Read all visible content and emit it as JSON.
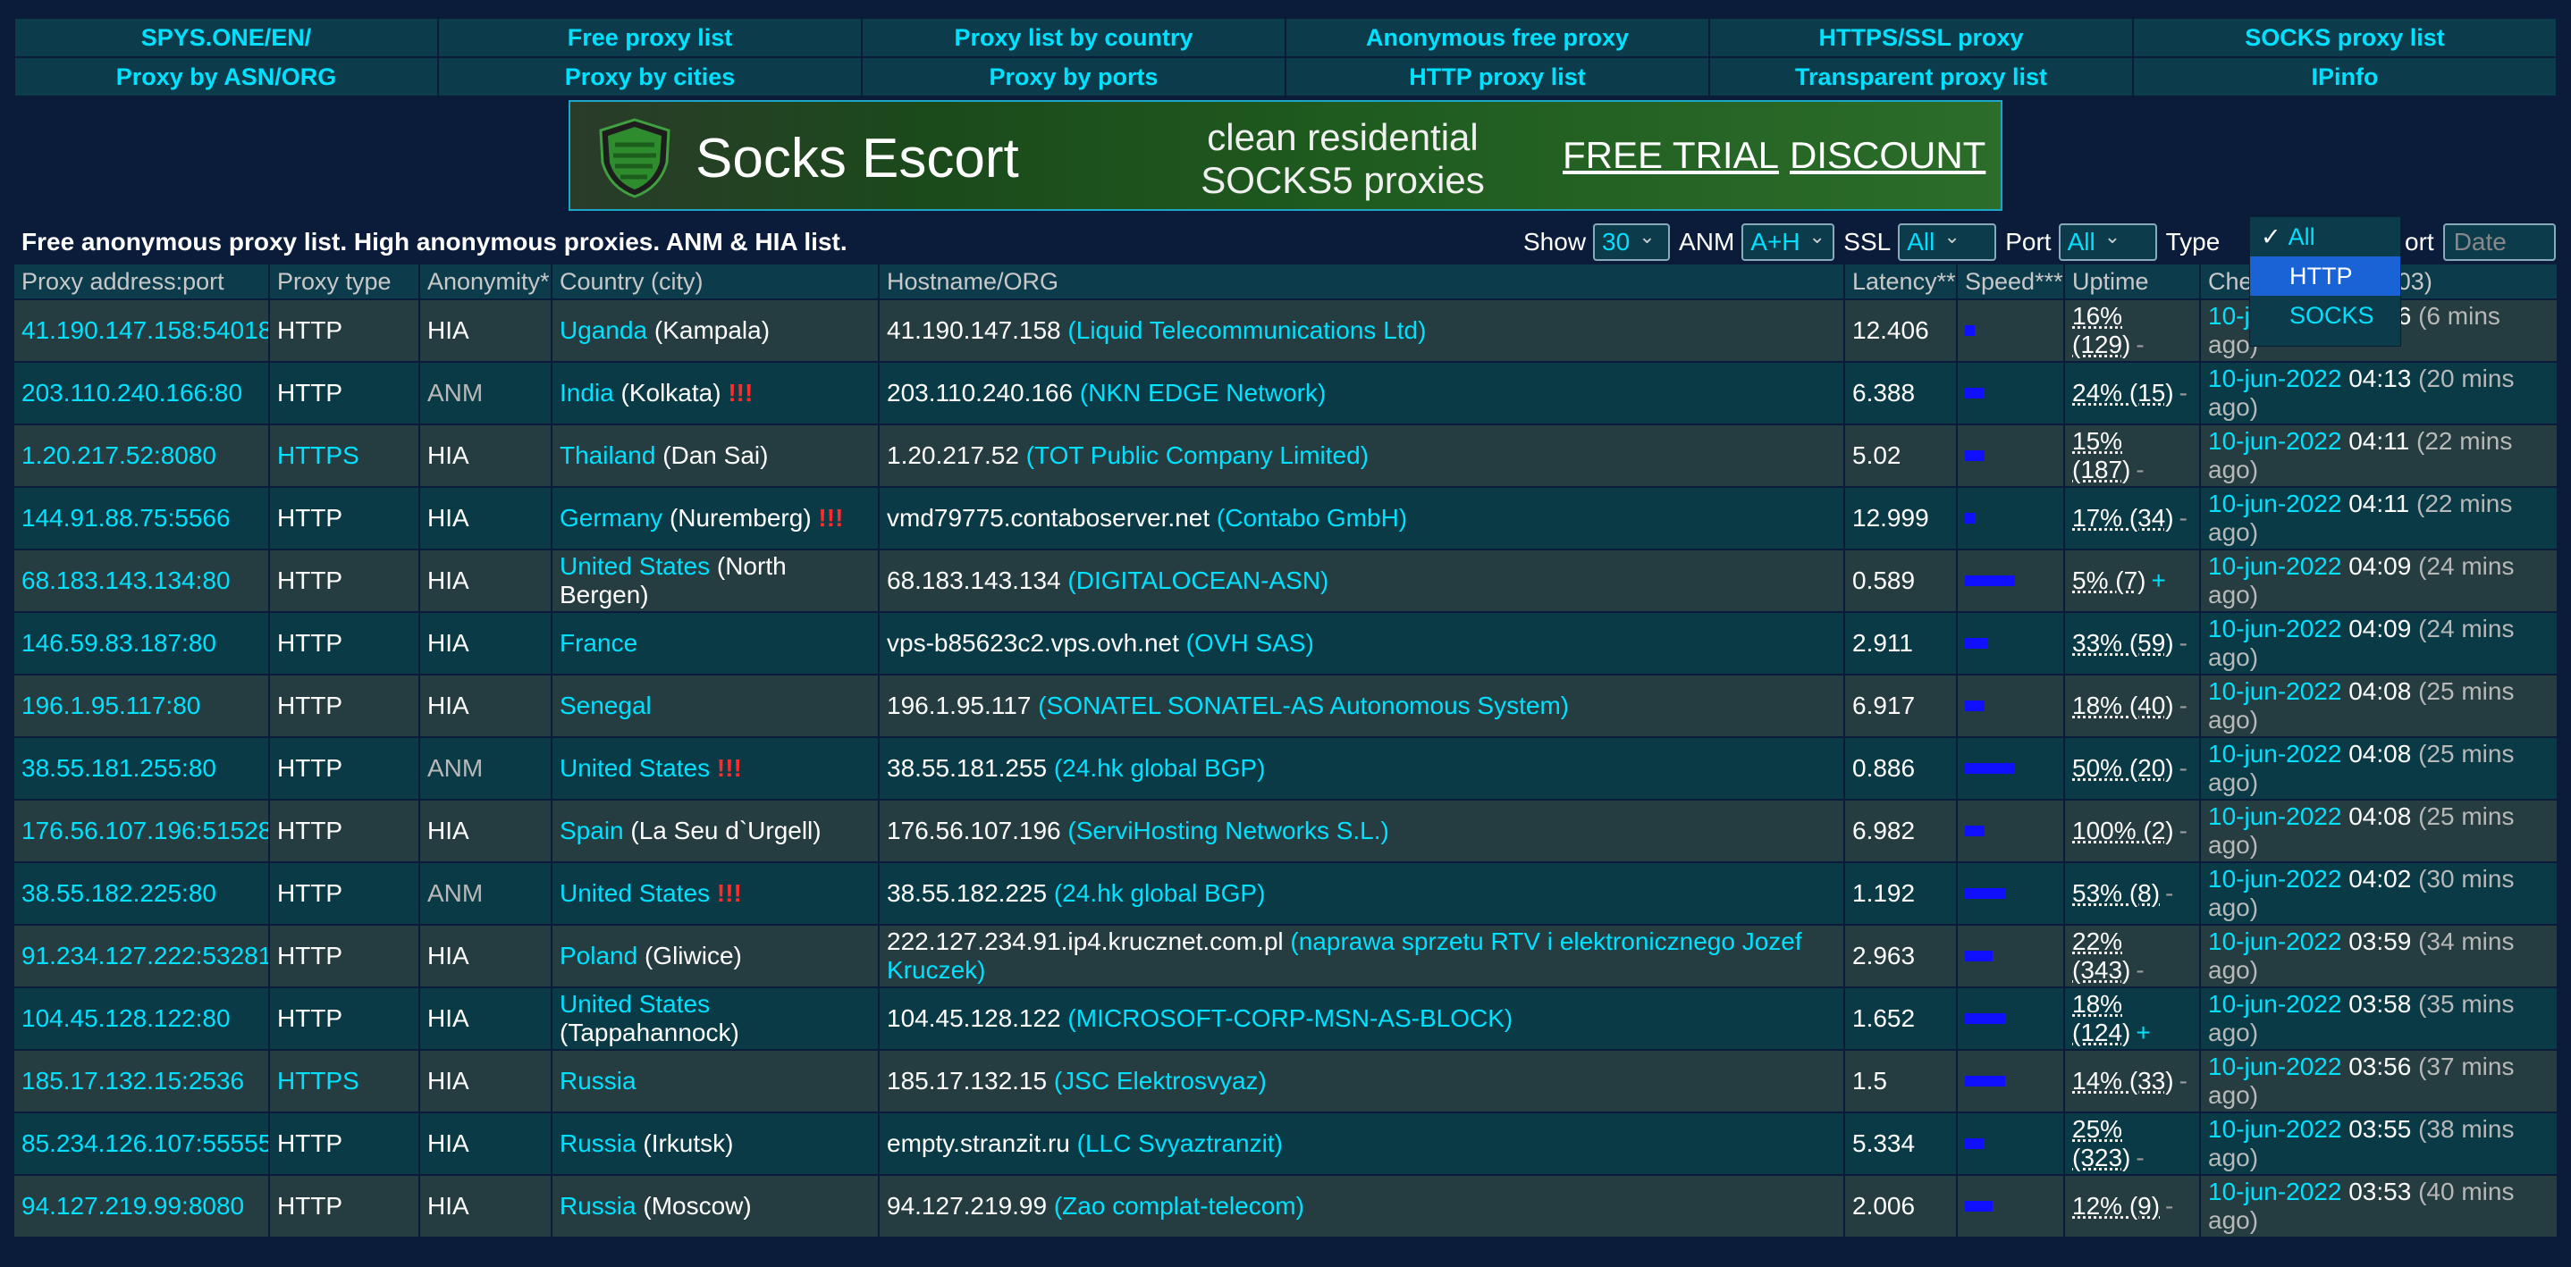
{
  "nav": [
    "SPYS.ONE/EN/",
    "Free proxy list",
    "Proxy list by country",
    "Anonymous free proxy",
    "HTTPS/SSL proxy",
    "SOCKS proxy list",
    "Proxy by ASN/ORG",
    "Proxy by cities",
    "Proxy by ports",
    "HTTP proxy list",
    "Transparent proxy list",
    "IPinfo"
  ],
  "banner": {
    "brand": "Socks Escort",
    "tagline_1": "clean residential",
    "tagline_2": "SOCKS5 proxies",
    "trial": "FREE TRIAL",
    "discount": "DISCOUNT"
  },
  "filter": {
    "title": "Free anonymous proxy list. High anonymous proxies. ANM & HIA list.",
    "show_label": "Show",
    "show_value": "30",
    "anm_label": "ANM",
    "anm_value": "A+H",
    "ssl_label": "SSL",
    "ssl_value": "All",
    "port_label": "Port",
    "port_value": "All",
    "type_label": "Type",
    "sort_label": "ort",
    "sort_value": "Date"
  },
  "type_dropdown": {
    "options": [
      "All",
      "HTTP",
      "SOCKS"
    ],
    "checked": "All",
    "highlighted": "HTTP"
  },
  "headers": [
    "Proxy address:port",
    "Proxy type",
    "Anonymity*",
    "Country (city)",
    "Hostname/ORG",
    "Latency**",
    "Speed***",
    "Uptime",
    "Che",
    "T+03)",
    "6 (6 mins"
  ],
  "rows": [
    {
      "addr": "41.190.147.158:54018",
      "type": "HTTP",
      "anon": "HIA",
      "country": "Uganda",
      "city": "(Kampala)",
      "warn": "",
      "host": "41.190.147.158",
      "org": "(Liquid Telecommunications Ltd)",
      "lat": "12.406",
      "speed": 0.2,
      "up": "16% (129)",
      "mark": "-",
      "date": "10-jun-2022",
      "time": "04:16",
      "ago": "(6 mins",
      "ago2": "ago)"
    },
    {
      "addr": "203.110.240.166:80",
      "type": "HTTP",
      "anon": "ANM",
      "country": "India",
      "city": "(Kolkata)",
      "warn": "!!!",
      "host": "203.110.240.166",
      "org": "(NKN EDGE Network)",
      "lat": "6.388",
      "speed": 0.4,
      "up": "24% (15)",
      "mark": "-",
      "date": "10-jun-2022",
      "time": "04:13",
      "ago": "(20 mins",
      "ago2": "ago)"
    },
    {
      "addr": "1.20.217.52:8080",
      "type": "HTTPS",
      "anon": "HIA",
      "country": "Thailand",
      "city": "(Dan Sai)",
      "warn": "",
      "host": "1.20.217.52",
      "org": "(TOT Public Company Limited)",
      "lat": "5.02",
      "speed": 0.4,
      "up": "15% (187)",
      "mark": "-",
      "date": "10-jun-2022",
      "time": "04:11",
      "ago": "(22 mins",
      "ago2": "ago)"
    },
    {
      "addr": "144.91.88.75:5566",
      "type": "HTTP",
      "anon": "HIA",
      "country": "Germany",
      "city": "(Nuremberg)",
      "warn": "!!!",
      "host": "vmd79775.contaboserver.net",
      "org": "(Contabo GmbH)",
      "lat": "12.999",
      "speed": 0.2,
      "up": "17% (34)",
      "mark": "-",
      "date": "10-jun-2022",
      "time": "04:11",
      "ago": "(22 mins",
      "ago2": "ago)"
    },
    {
      "addr": "68.183.143.134:80",
      "type": "HTTP",
      "anon": "HIA",
      "country": "United States",
      "city": "(North Bergen)",
      "warn": "",
      "host": "68.183.143.134",
      "org": "(DIGITALOCEAN-ASN)",
      "lat": "0.589",
      "speed": 1.0,
      "up": "5% (7)",
      "mark": "+",
      "date": "10-jun-2022",
      "time": "04:09",
      "ago": "(24 mins",
      "ago2": "ago)"
    },
    {
      "addr": "146.59.83.187:80",
      "type": "HTTP",
      "anon": "HIA",
      "country": "France",
      "city": "",
      "warn": "",
      "host": "vps-b85623c2.vps.ovh.net",
      "org": "(OVH SAS)",
      "lat": "2.911",
      "speed": 0.45,
      "up": "33% (59)",
      "mark": "-",
      "date": "10-jun-2022",
      "time": "04:09",
      "ago": "(24 mins",
      "ago2": "ago)"
    },
    {
      "addr": "196.1.95.117:80",
      "type": "HTTP",
      "anon": "HIA",
      "country": "Senegal",
      "city": "",
      "warn": "",
      "host": "196.1.95.117",
      "org": "(SONATEL SONATEL-AS Autonomous System)",
      "lat": "6.917",
      "speed": 0.4,
      "up": "18% (40)",
      "mark": "-",
      "date": "10-jun-2022",
      "time": "04:08",
      "ago": "(25 mins",
      "ago2": "ago)"
    },
    {
      "addr": "38.55.181.255:80",
      "type": "HTTP",
      "anon": "ANM",
      "country": "United States",
      "city": "",
      "warn": "!!!",
      "host": "38.55.181.255",
      "org": "(24.hk global BGP)",
      "lat": "0.886",
      "speed": 1.0,
      "up": "50% (20)",
      "mark": "-",
      "date": "10-jun-2022",
      "time": "04:08",
      "ago": "(25 mins",
      "ago2": "ago)"
    },
    {
      "addr": "176.56.107.196:51528",
      "type": "HTTP",
      "anon": "HIA",
      "country": "Spain",
      "city": "(La Seu d`Urgell)",
      "warn": "",
      "host": "176.56.107.196",
      "org": "(ServiHosting Networks S.L.)",
      "lat": "6.982",
      "speed": 0.4,
      "up": "100% (2)",
      "mark": "-",
      "date": "10-jun-2022",
      "time": "04:08",
      "ago": "(25 mins",
      "ago2": "ago)"
    },
    {
      "addr": "38.55.182.225:80",
      "type": "HTTP",
      "anon": "ANM",
      "country": "United States",
      "city": "",
      "warn": "!!!",
      "host": "38.55.182.225",
      "org": "(24.hk global BGP)",
      "lat": "1.192",
      "speed": 0.8,
      "up": "53% (8)",
      "mark": "-",
      "date": "10-jun-2022",
      "time": "04:02",
      "ago": "(30 mins",
      "ago2": "ago)"
    },
    {
      "addr": "91.234.127.222:53281",
      "type": "HTTP",
      "anon": "HIA",
      "country": "Poland",
      "city": "(Gliwice)",
      "warn": "",
      "host": "222.127.234.91.ip4.krucznet.com.pl",
      "org": "(naprawa sprzetu RTV i elektronicznego Jozef Kruczek)",
      "lat": "2.963",
      "speed": 0.55,
      "up": "22% (343)",
      "mark": "-",
      "date": "10-jun-2022",
      "time": "03:59",
      "ago": "(34 mins",
      "ago2": "ago)"
    },
    {
      "addr": "104.45.128.122:80",
      "type": "HTTP",
      "anon": "HIA",
      "country": "United States",
      "city": "(Tappahannock)",
      "warn": "",
      "host": "104.45.128.122",
      "org": "(MICROSOFT-CORP-MSN-AS-BLOCK)",
      "lat": "1.652",
      "speed": 0.8,
      "up": "18% (124)",
      "mark": "+",
      "date": "10-jun-2022",
      "time": "03:58",
      "ago": "(35 mins",
      "ago2": "ago)"
    },
    {
      "addr": "185.17.132.15:2536",
      "type": "HTTPS",
      "anon": "HIA",
      "country": "Russia",
      "city": "",
      "warn": "",
      "host": "185.17.132.15",
      "org": "(JSC Elektrosvyaz)",
      "lat": "1.5",
      "speed": 0.8,
      "up": "14% (33)",
      "mark": "-",
      "date": "10-jun-2022",
      "time": "03:56",
      "ago": "(37 mins",
      "ago2": "ago)"
    },
    {
      "addr": "85.234.126.107:55555",
      "type": "HTTP",
      "anon": "HIA",
      "country": "Russia",
      "city": "(Irkutsk)",
      "warn": "",
      "host": "empty.stranzit.ru",
      "org": "(LLC Svyaztranzit)",
      "lat": "5.334",
      "speed": 0.4,
      "up": "25% (323)",
      "mark": "-",
      "date": "10-jun-2022",
      "time": "03:55",
      "ago": "(38 mins",
      "ago2": "ago)"
    },
    {
      "addr": "94.127.219.99:8080",
      "type": "HTTP",
      "anon": "HIA",
      "country": "Russia",
      "city": "(Moscow)",
      "warn": "",
      "host": "94.127.219.99",
      "org": "(Zao complat-telecom)",
      "lat": "2.006",
      "speed": 0.55,
      "up": "12% (9)",
      "mark": "-",
      "date": "10-jun-2022",
      "time": "03:53",
      "ago": "(40 mins",
      "ago2": "ago)"
    }
  ]
}
